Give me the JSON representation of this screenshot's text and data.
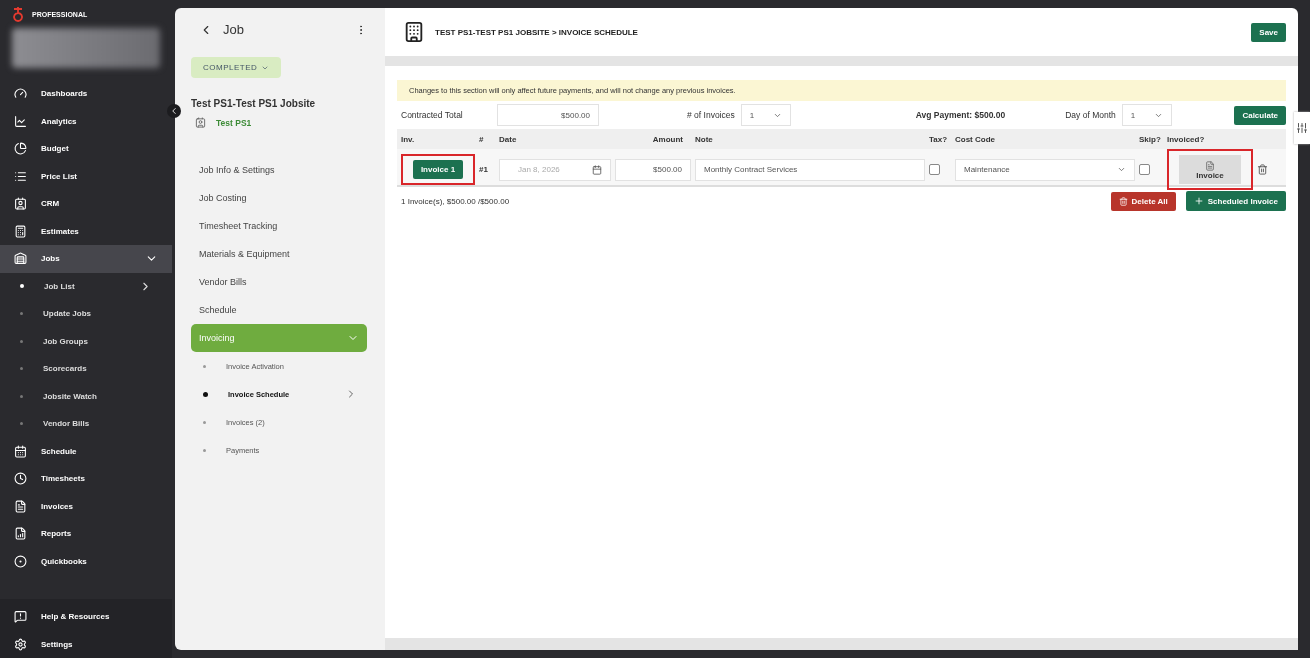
{
  "sidebar": {
    "brand": "PROFESSIONAL",
    "items": [
      {
        "label": "Dashboards",
        "selected": false
      },
      {
        "label": "Analytics",
        "selected": false
      },
      {
        "label": "Budget",
        "selected": false
      },
      {
        "label": "Price List",
        "selected": false
      },
      {
        "label": "CRM",
        "selected": false
      },
      {
        "label": "Estimates",
        "selected": false
      },
      {
        "label": "Jobs",
        "selected": true,
        "expanded": true,
        "children": [
          {
            "label": "Job List",
            "selected": true
          },
          {
            "label": "Update Jobs",
            "selected": false
          },
          {
            "label": "Job Groups",
            "selected": false
          },
          {
            "label": "Scorecards",
            "selected": false
          },
          {
            "label": "Jobsite Watch",
            "selected": false
          },
          {
            "label": "Vendor Bills",
            "selected": false
          }
        ]
      },
      {
        "label": "Schedule",
        "selected": false
      },
      {
        "label": "Timesheets",
        "selected": false
      },
      {
        "label": "Invoices",
        "selected": false
      },
      {
        "label": "Reports",
        "selected": false
      },
      {
        "label": "Quickbooks",
        "selected": false
      }
    ],
    "footer": [
      {
        "label": "Help & Resources",
        "selected": false
      },
      {
        "label": "Settings",
        "selected": false
      }
    ]
  },
  "job_panel": {
    "title": "Job",
    "status": "COMPLETED",
    "job_name": "Test PS1-Test PS1 Jobsite",
    "client": "Test PS1",
    "nav": [
      {
        "label": "Job Info & Settings",
        "selected": false
      },
      {
        "label": "Job Costing",
        "selected": false
      },
      {
        "label": "Timesheet Tracking",
        "selected": false
      },
      {
        "label": "Materials & Equipment",
        "selected": false
      },
      {
        "label": "Vendor Bills",
        "selected": false
      },
      {
        "label": "Schedule",
        "selected": false
      },
      {
        "label": "Invoicing",
        "selected": true,
        "expanded": true,
        "children": [
          {
            "label": "Invoice Activation",
            "selected": false
          },
          {
            "label": "Invoice Schedule",
            "selected": true
          },
          {
            "label": "Invoices (2)",
            "selected": false
          },
          {
            "label": "Payments",
            "selected": false
          }
        ]
      }
    ]
  },
  "main": {
    "title": "TEST PS1-TEST PS1 JOBSITE > INVOICE SCHEDULE",
    "save": "Save",
    "notice": "Changes to this section will only affect future payments, and will not change any previous invoices.",
    "controls": {
      "contracted_total_label": "Contracted Total",
      "contracted_total": "$500.00",
      "invoices_label": "# of Invoices",
      "invoices": "1",
      "avg_payment": "Avg Payment: $500.00",
      "day_label": "Day of Month",
      "day": "1",
      "calculate": "Calculate"
    },
    "columns": [
      "Inv.",
      "#",
      "Date",
      "Amount",
      "Note",
      "Tax?",
      "Cost Code",
      "Skip?",
      "Invoiced?"
    ],
    "rows": [
      {
        "invoice": "Invoice 1",
        "invoice_highlighted": true,
        "number": "#1",
        "date": "Jan 8, 2026",
        "amount": "$500.00",
        "note": "Monthly Contract Services",
        "tax": false,
        "cost_code": "Maintenance",
        "skip": false,
        "invoiced": "Invoice",
        "invoiced_highlighted": true
      }
    ],
    "summary": "1 Invoice(s), $500.00 /$500.00",
    "delete_all": "Delete All",
    "add": "Scheduled Invoice"
  }
}
